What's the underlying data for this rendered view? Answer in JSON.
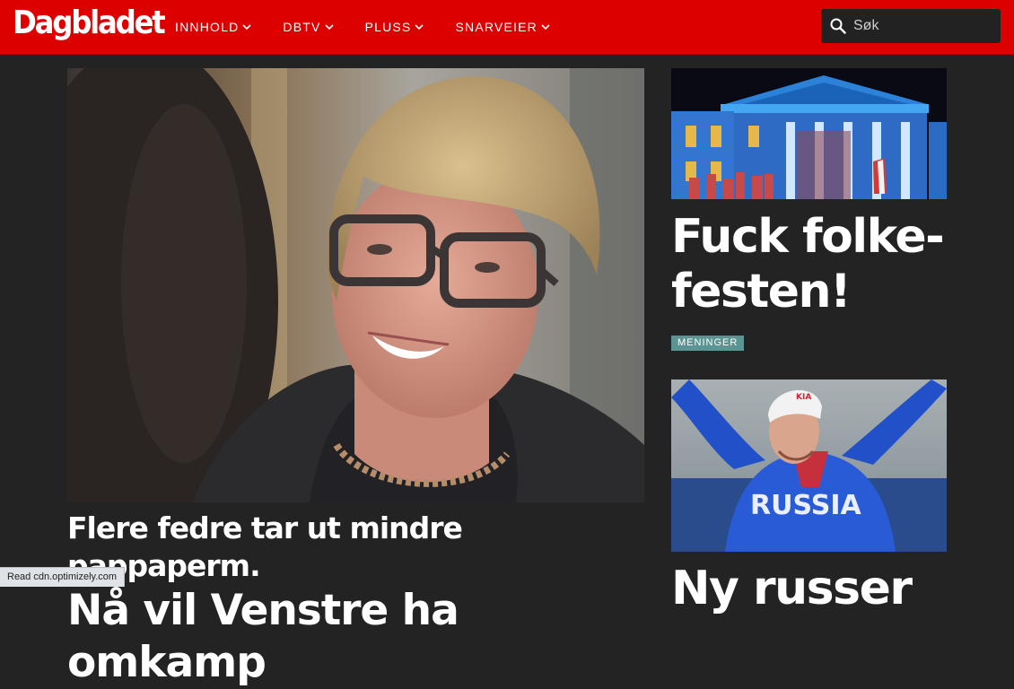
{
  "header": {
    "logo": "Dagbladet",
    "nav": [
      "INNHOLD",
      "DBTV",
      "PLUSS",
      "SNARVEIER"
    ],
    "search_placeholder": "Søk"
  },
  "main_article": {
    "kicker": "Flere fedre tar ut mindre pappaperm.",
    "headline": "Nå vil Venstre ha omkamp"
  },
  "side_article_1": {
    "headline_line1": "Fuck folke-",
    "headline_line2": "festen!",
    "tag": "MENINGER"
  },
  "side_article_2": {
    "headline": "Ny russer"
  },
  "status_bar": "Read cdn.optimizely.com",
  "colors": {
    "brand_red": "#dd0000",
    "background": "#232323",
    "tag": "#5b9593"
  }
}
